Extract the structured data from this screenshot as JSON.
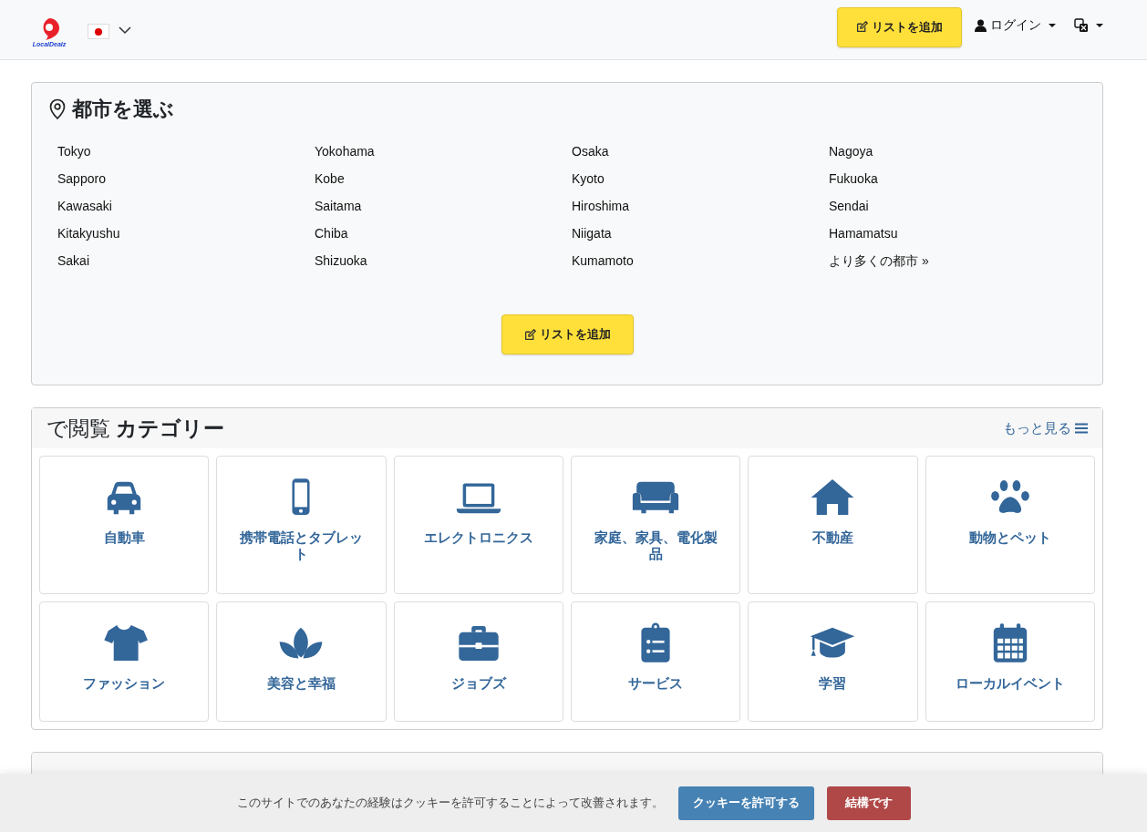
{
  "header": {
    "logo_text": "LocalDealz",
    "add_button": "リストを追加",
    "login": "ログイン"
  },
  "cities": {
    "title": "都市を選ぶ",
    "items": [
      "Tokyo",
      "Yokohama",
      "Osaka",
      "Nagoya",
      "Sapporo",
      "Kobe",
      "Kyoto",
      "Fukuoka",
      "Kawasaki",
      "Saitama",
      "Hiroshima",
      "Sendai",
      "Kitakyushu",
      "Chiba",
      "Niigata",
      "Hamamatsu",
      "Sakai",
      "Shizuoka",
      "Kumamoto",
      "より多くの都市 »"
    ],
    "add_button": "リストを追加"
  },
  "categories": {
    "title": "で閲覧 **カテゴリー**",
    "more": "もっと見る",
    "items": [
      "自動車",
      "携帯電話とタブレット",
      "エレクトロニクス",
      "家庭、家具、電化製品",
      "不動産",
      "動物とペット",
      "ファッション",
      "美容と幸福",
      "ジョブズ",
      "サービス",
      "学習",
      "ローカルイベント"
    ]
  },
  "cookie": {
    "message": "このサイトでのあなたの経験はクッキーを許可することによって改善されます。",
    "accept": "クッキーを許可する",
    "decline": "結構です"
  }
}
